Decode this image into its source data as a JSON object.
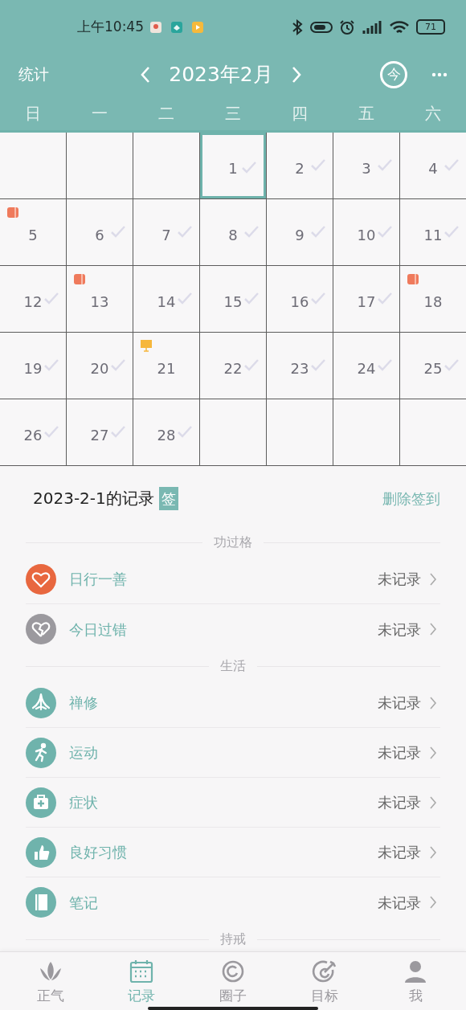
{
  "status_bar": {
    "time": "上午10:45",
    "battery": "71"
  },
  "header": {
    "left": "统计",
    "title": "2023年2月",
    "today": "今"
  },
  "weekdays": [
    "日",
    "一",
    "二",
    "三",
    "四",
    "五",
    "六"
  ],
  "calendar": {
    "cells": [
      {
        "kind": "blank"
      },
      {
        "kind": "blank"
      },
      {
        "kind": "blank"
      },
      {
        "kind": "day",
        "day": "1",
        "checked": true,
        "selected": true
      },
      {
        "kind": "day",
        "day": "2",
        "checked": true,
        "selected": false
      },
      {
        "kind": "day",
        "day": "3",
        "checked": true,
        "selected": false
      },
      {
        "kind": "day",
        "day": "4",
        "checked": true,
        "selected": false
      },
      {
        "kind": "day",
        "day": "5",
        "checked": false,
        "selected": false,
        "marker": {
          "kind": "roll"
        }
      },
      {
        "kind": "day",
        "day": "6",
        "checked": true,
        "selected": false
      },
      {
        "kind": "day",
        "day": "7",
        "checked": true,
        "selected": false
      },
      {
        "kind": "day",
        "day": "8",
        "checked": true,
        "selected": false
      },
      {
        "kind": "day",
        "day": "9",
        "checked": true,
        "selected": false
      },
      {
        "kind": "day",
        "day": "10",
        "checked": true,
        "selected": false
      },
      {
        "kind": "day",
        "day": "11",
        "checked": true,
        "selected": false
      },
      {
        "kind": "day",
        "day": "12",
        "checked": true,
        "selected": false
      },
      {
        "kind": "day",
        "day": "13",
        "checked": false,
        "selected": false,
        "marker": {
          "kind": "roll"
        }
      },
      {
        "kind": "day",
        "day": "14",
        "checked": true,
        "selected": false
      },
      {
        "kind": "day",
        "day": "15",
        "checked": true,
        "selected": false
      },
      {
        "kind": "day",
        "day": "16",
        "checked": true,
        "selected": false
      },
      {
        "kind": "day",
        "day": "17",
        "checked": true,
        "selected": false
      },
      {
        "kind": "day",
        "day": "18",
        "checked": false,
        "selected": false,
        "marker": {
          "kind": "roll"
        }
      },
      {
        "kind": "day",
        "day": "19",
        "checked": true,
        "selected": false
      },
      {
        "kind": "day",
        "day": "20",
        "checked": true,
        "selected": false
      },
      {
        "kind": "day",
        "day": "21",
        "checked": false,
        "selected": false,
        "marker": {
          "kind": "board"
        }
      },
      {
        "kind": "day",
        "day": "22",
        "checked": true,
        "selected": false
      },
      {
        "kind": "day",
        "day": "23",
        "checked": true,
        "selected": false
      },
      {
        "kind": "day",
        "day": "24",
        "checked": true,
        "selected": false
      },
      {
        "kind": "day",
        "day": "25",
        "checked": true,
        "selected": false
      },
      {
        "kind": "day",
        "day": "26",
        "checked": true,
        "selected": false
      },
      {
        "kind": "day",
        "day": "27",
        "checked": true,
        "selected": false
      },
      {
        "kind": "day",
        "day": "28",
        "checked": true,
        "selected": false
      },
      {
        "kind": "blank"
      },
      {
        "kind": "blank"
      },
      {
        "kind": "blank"
      },
      {
        "kind": "blank"
      }
    ]
  },
  "record": {
    "title": "2023-2-1的记录",
    "badge": "签",
    "action": "删除签到",
    "groups": [
      {
        "heading": "功过格",
        "items": [
          {
            "label": "日行一善",
            "status": "未记录",
            "color": "#e8673f"
          },
          {
            "label": "今日过错",
            "status": "未记录",
            "color": "#9b999e"
          }
        ]
      },
      {
        "heading": "生活",
        "items": [
          {
            "label": "禅修",
            "status": "未记录",
            "color": "#6fb3ac"
          },
          {
            "label": "运动",
            "status": "未记录",
            "color": "#6fb3ac"
          },
          {
            "label": "症状",
            "status": "未记录",
            "color": "#6fb3ac"
          },
          {
            "label": "良好习惯",
            "status": "未记录",
            "color": "#6fb3ac"
          },
          {
            "label": "笔记",
            "status": "未记录",
            "color": "#6fb3ac"
          }
        ]
      },
      {
        "heading": "持戒"
      }
    ]
  },
  "nav": [
    {
      "label": "正气",
      "selected": false
    },
    {
      "label": "记录",
      "selected": true
    },
    {
      "label": "圈子",
      "selected": false
    },
    {
      "label": "目标",
      "selected": false
    },
    {
      "label": "我",
      "selected": false
    }
  ]
}
